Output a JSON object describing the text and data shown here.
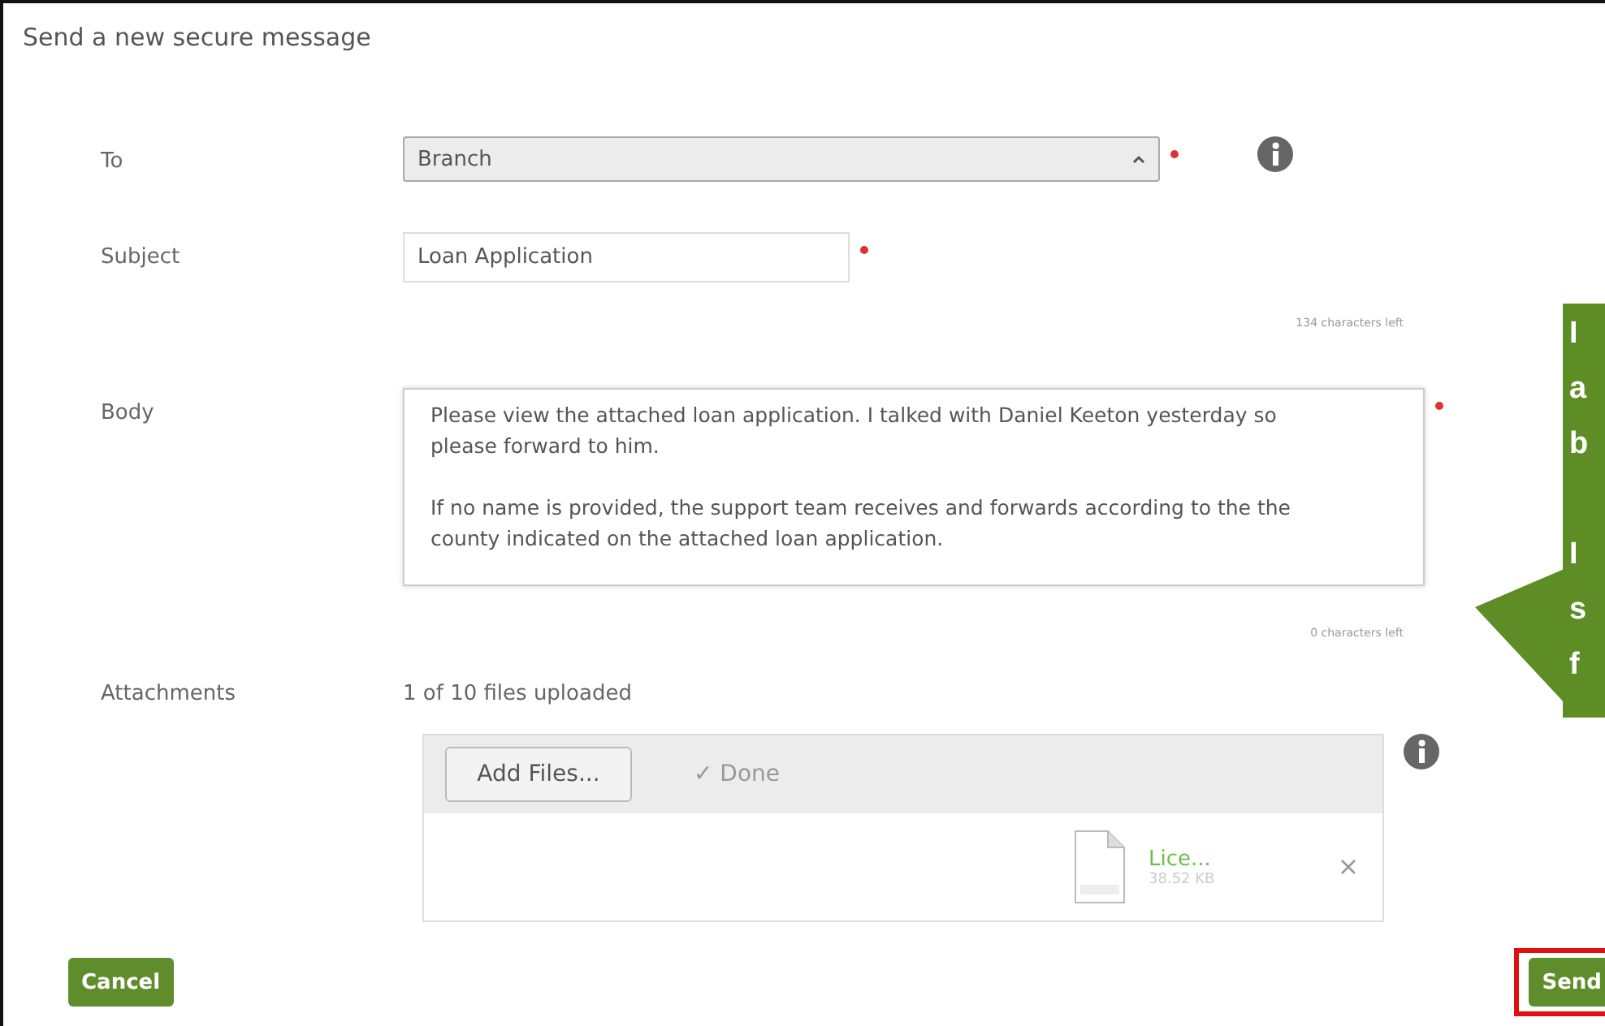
{
  "title": "Send a new secure message",
  "to": {
    "label": "To",
    "value": "Branch",
    "required": true
  },
  "subject": {
    "label": "Subject",
    "value": "Loan Application",
    "required": true,
    "counter": "134 characters left"
  },
  "body": {
    "label": "Body",
    "paragraphs": [
      "Please view the attached loan application. I talked with Daniel Keeton yesterday so please forward to him.",
      "If no name is provided, the support team receives and forwards according to the the county indicated on the attached loan application."
    ],
    "required": true,
    "counter": "0 characters left"
  },
  "attachments": {
    "label": "Attachments",
    "status": "1 of 10 files uploaded",
    "add_button": "Add Files...",
    "done": "✓ Done",
    "files": [
      {
        "name": "Lice...",
        "size": "38.52 KB"
      }
    ]
  },
  "callout": {
    "paragraphs": [
      [
        "I",
        "a",
        "b"
      ],
      [
        "I",
        "s",
        "f"
      ]
    ]
  },
  "buttons": {
    "cancel": "Cancel",
    "send": "Send",
    "send_highlighted": true
  }
}
